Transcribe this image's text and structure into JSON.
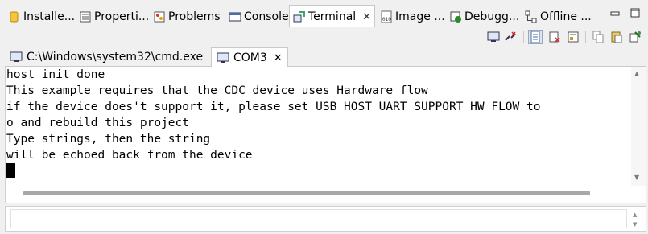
{
  "view_tabs": [
    {
      "label": "Installe...",
      "icon": "install-icon"
    },
    {
      "label": "Properti...",
      "icon": "properties-icon"
    },
    {
      "label": "Problems",
      "icon": "problems-icon"
    },
    {
      "label": "Console",
      "icon": "console-icon"
    },
    {
      "label": "Terminal",
      "icon": "terminal-icon",
      "active": true
    },
    {
      "label": "Image ...",
      "icon": "image-icon"
    },
    {
      "label": "Debugg...",
      "icon": "debugger-icon"
    },
    {
      "label": "Offline ...",
      "icon": "offline-icon"
    }
  ],
  "close_glyph": "✕",
  "terminal_tabs": [
    {
      "label": "C:\\Windows\\system32\\cmd.exe",
      "icon": "cmd-terminal-icon"
    },
    {
      "label": "COM3",
      "icon": "serial-terminal-icon",
      "active": true
    }
  ],
  "terminal_lines": [
    "host init done",
    "This example requires that the CDC device uses Hardware flow",
    "if the device does't support it, please set USB_HOST_UART_SUPPORT_HW_FLOW to",
    "o and rebuild this project",
    "Type strings, then the string",
    "will be echoed back from the device"
  ],
  "toolbar_icons": [
    "new-terminal-icon",
    "disconnect-icon",
    "scroll-lock-icon",
    "clear-terminal-icon",
    "settings-icon",
    "copy-icon",
    "paste-icon",
    "pin-icon"
  ],
  "input": {
    "value": "",
    "placeholder": ""
  },
  "colors": {
    "tab_active": "#ffffff",
    "background": "#f0f0f0",
    "pressed": "#dfe6ee"
  }
}
